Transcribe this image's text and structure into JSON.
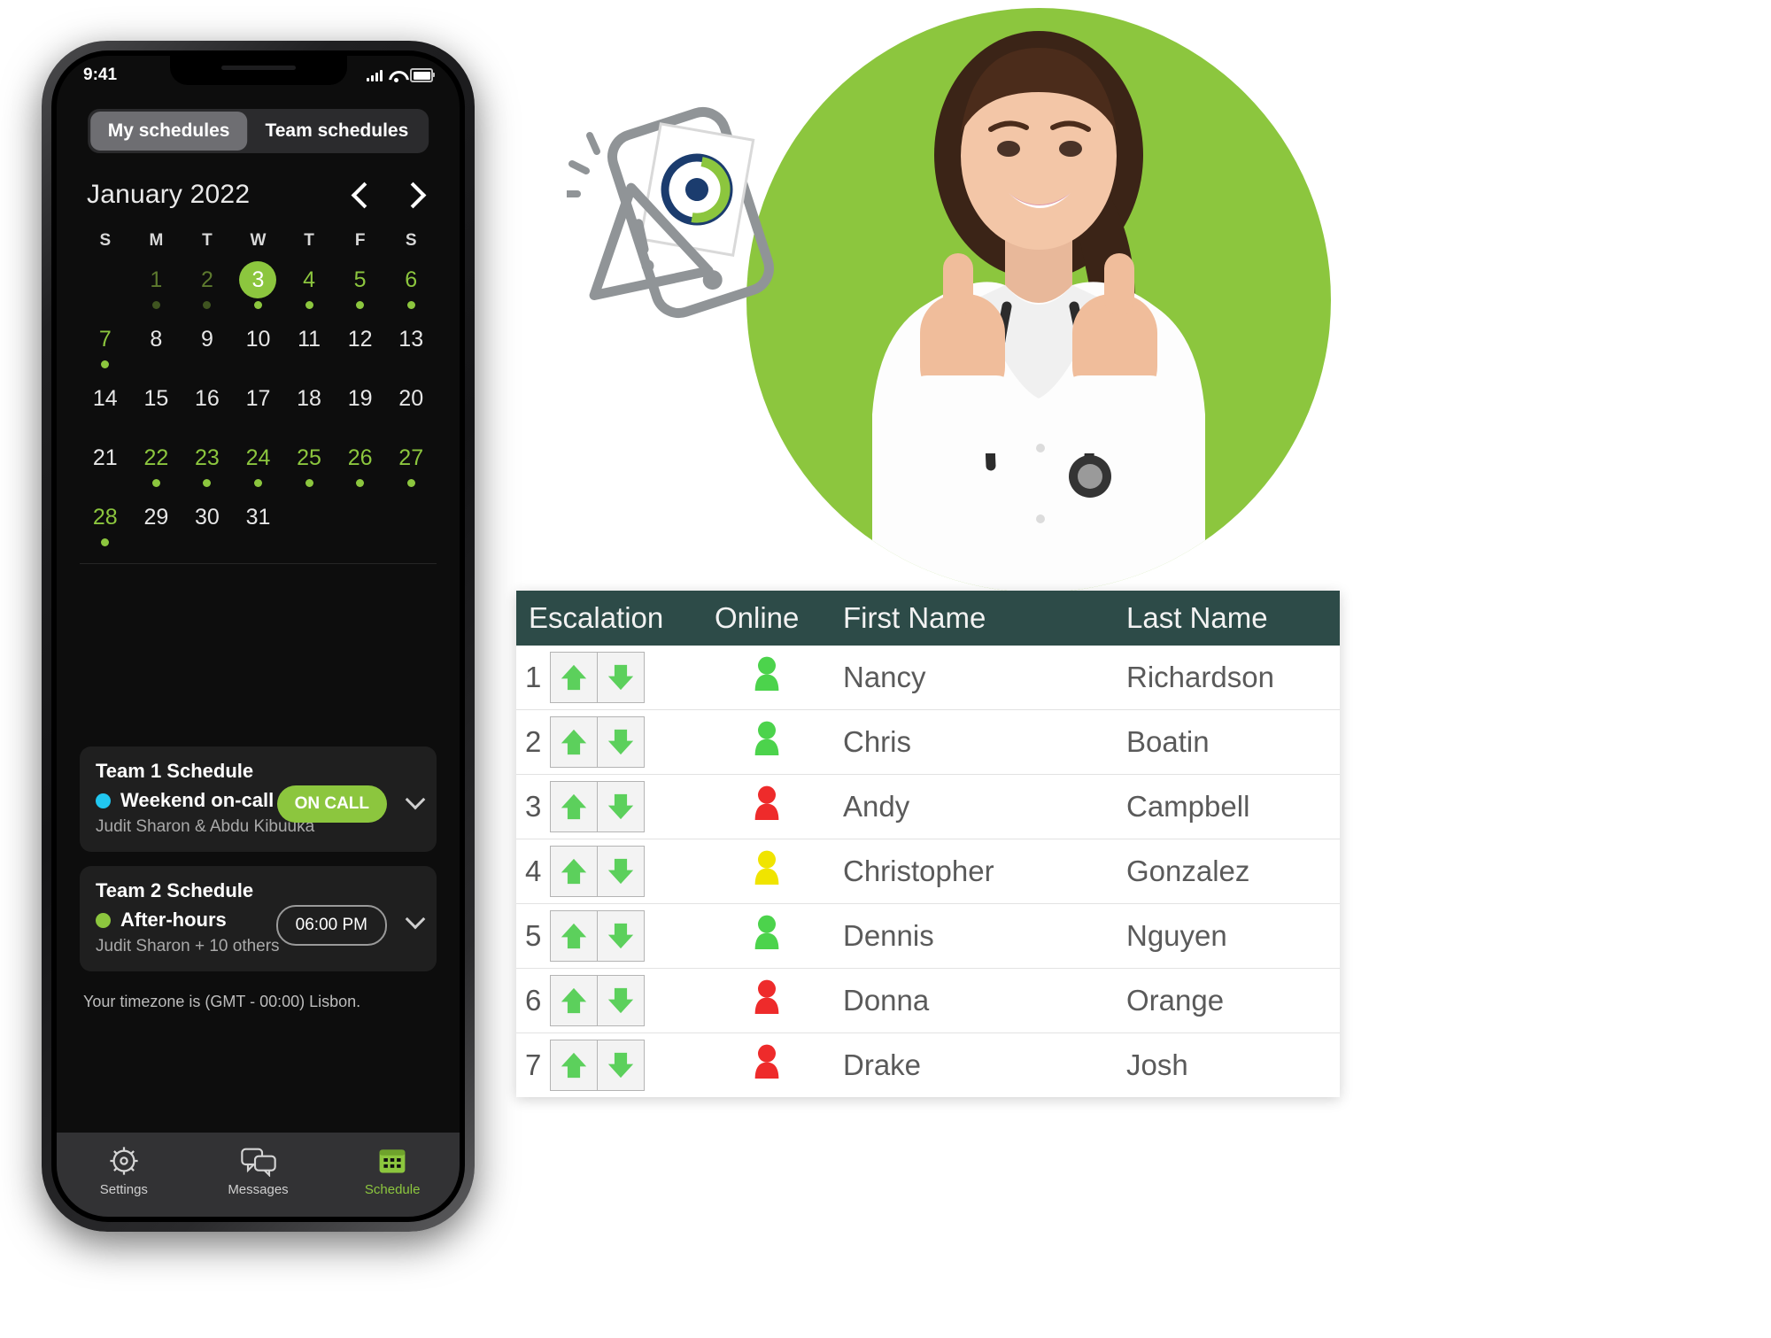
{
  "phone": {
    "status_bar": {
      "time": "9:41",
      "signal_icon": "cellular-bars-icon",
      "wifi_icon": "wifi-icon",
      "battery_icon": "battery-icon"
    },
    "tabs": [
      {
        "label": "My schedules",
        "active": true
      },
      {
        "label": "Team schedules",
        "active": false
      }
    ],
    "calendar": {
      "title": "January 2022",
      "prev_icon": "chevron-left-icon",
      "next_icon": "chevron-right-icon",
      "day_initials": [
        "S",
        "M",
        "T",
        "W",
        "T",
        "F",
        "S"
      ],
      "weeks": [
        [
          {
            "day": "",
            "state": "empty",
            "dot": "none"
          },
          {
            "day": "1",
            "state": "dim",
            "dot": "dim"
          },
          {
            "day": "2",
            "state": "dim",
            "dot": "dim"
          },
          {
            "day": "3",
            "state": "today",
            "dot": "on"
          },
          {
            "day": "4",
            "state": "on",
            "dot": "on"
          },
          {
            "day": "5",
            "state": "on",
            "dot": "on"
          },
          {
            "day": "6",
            "state": "on",
            "dot": "on"
          }
        ],
        [
          {
            "day": "7",
            "state": "on",
            "dot": "on"
          },
          {
            "day": "8",
            "state": "off",
            "dot": "none"
          },
          {
            "day": "9",
            "state": "off",
            "dot": "none"
          },
          {
            "day": "10",
            "state": "off",
            "dot": "none"
          },
          {
            "day": "11",
            "state": "off",
            "dot": "none"
          },
          {
            "day": "12",
            "state": "off",
            "dot": "none"
          },
          {
            "day": "13",
            "state": "off",
            "dot": "none"
          }
        ],
        [
          {
            "day": "14",
            "state": "off",
            "dot": "none"
          },
          {
            "day": "15",
            "state": "off",
            "dot": "none"
          },
          {
            "day": "16",
            "state": "off",
            "dot": "none"
          },
          {
            "day": "17",
            "state": "off",
            "dot": "none"
          },
          {
            "day": "18",
            "state": "off",
            "dot": "none"
          },
          {
            "day": "19",
            "state": "off",
            "dot": "none"
          },
          {
            "day": "20",
            "state": "off",
            "dot": "none"
          }
        ],
        [
          {
            "day": "21",
            "state": "off",
            "dot": "none"
          },
          {
            "day": "22",
            "state": "on",
            "dot": "on"
          },
          {
            "day": "23",
            "state": "on",
            "dot": "on"
          },
          {
            "day": "24",
            "state": "on",
            "dot": "on"
          },
          {
            "day": "25",
            "state": "on",
            "dot": "on"
          },
          {
            "day": "26",
            "state": "on",
            "dot": "on"
          },
          {
            "day": "27",
            "state": "on",
            "dot": "on"
          }
        ],
        [
          {
            "day": "28",
            "state": "on",
            "dot": "on"
          },
          {
            "day": "29",
            "state": "off",
            "dot": "none"
          },
          {
            "day": "30",
            "state": "off",
            "dot": "none"
          },
          {
            "day": "31",
            "state": "off",
            "dot": "none"
          },
          {
            "day": "",
            "state": "empty",
            "dot": "none"
          },
          {
            "day": "",
            "state": "empty",
            "dot": "none"
          },
          {
            "day": "",
            "state": "empty",
            "dot": "none"
          }
        ]
      ]
    },
    "schedule_cards": [
      {
        "title": "Team 1 Schedule",
        "bullet_color": "#21c7f0",
        "shift": "Weekend on-call",
        "people": "Judit Sharon & Abdu Kibuuka",
        "status": "ON CALL",
        "status_style": "filled",
        "expand_icon": "chevron-down-icon"
      },
      {
        "title": "Team 2 Schedule",
        "bullet_color": "#8cc63e",
        "shift": "After-hours",
        "people": "Judit Sharon + 10 others",
        "status": "06:00 PM",
        "status_style": "outline",
        "expand_icon": "chevron-down-icon"
      }
    ],
    "timezone_note": "Your timezone is  (GMT - 00:00) Lisbon.",
    "tabbar": [
      {
        "label": "Settings",
        "icon": "gear-icon",
        "active": false
      },
      {
        "label": "Messages",
        "icon": "chat-bubbles-icon",
        "active": false
      },
      {
        "label": "Schedule",
        "icon": "calendar-icon",
        "active": true
      }
    ]
  },
  "illustration": {
    "phone_icon": "smartphone-icon",
    "alert_icon": "warning-triangle-icon",
    "app_logo": "circular-arrows-logo"
  },
  "hero": {
    "circle_color": "#8cc63e",
    "subject": "nurse-thumbs-up-photo"
  },
  "table": {
    "header_bg": "#2d4b48",
    "columns": [
      "Escalation",
      "Online",
      "First Name",
      "Last Name"
    ],
    "up_icon": "arrow-up-icon",
    "down_icon": "arrow-down-icon",
    "online_icon": "person-status-icon",
    "status_colors": {
      "online": "#4cd34c",
      "offline": "#ee2b2b",
      "away": "#f0e400"
    },
    "rows": [
      {
        "escalation": "1",
        "online": "online",
        "first_name": "Nancy",
        "last_name": "Richardson"
      },
      {
        "escalation": "2",
        "online": "online",
        "first_name": "Chris",
        "last_name": "Boatin"
      },
      {
        "escalation": "3",
        "online": "offline",
        "first_name": "Andy",
        "last_name": "Campbell"
      },
      {
        "escalation": "4",
        "online": "away",
        "first_name": "Christopher",
        "last_name": "Gonzalez"
      },
      {
        "escalation": "5",
        "online": "online",
        "first_name": "Dennis",
        "last_name": "Nguyen"
      },
      {
        "escalation": "6",
        "online": "offline",
        "first_name": "Donna",
        "last_name": "Orange"
      },
      {
        "escalation": "7",
        "online": "offline",
        "first_name": "Drake",
        "last_name": "Josh"
      }
    ]
  }
}
